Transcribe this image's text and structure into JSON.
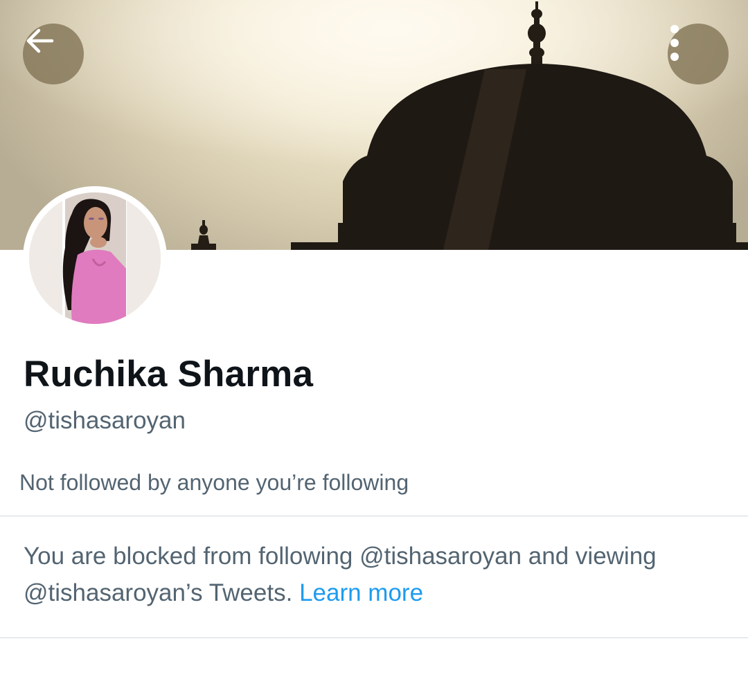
{
  "header": {
    "back_icon": "arrow-left-icon",
    "more_icon": "more-vertical-icon",
    "banner_image": "mosque-dome-silhouette-at-sunset",
    "button_color": "#847658"
  },
  "profile": {
    "avatar_image": "woman-in-pink-top-photo",
    "display_name": "Ruchika Sharma",
    "handle": "@tishasaroyan",
    "followers_you_know": "Not followed by anyone you’re following"
  },
  "blocked_notice": {
    "text": "You are blocked from following @tishasaroyan and viewing @tishasaroyan’s Tweets.",
    "link_label": "Learn more",
    "link_color": "#1d9bf0"
  }
}
